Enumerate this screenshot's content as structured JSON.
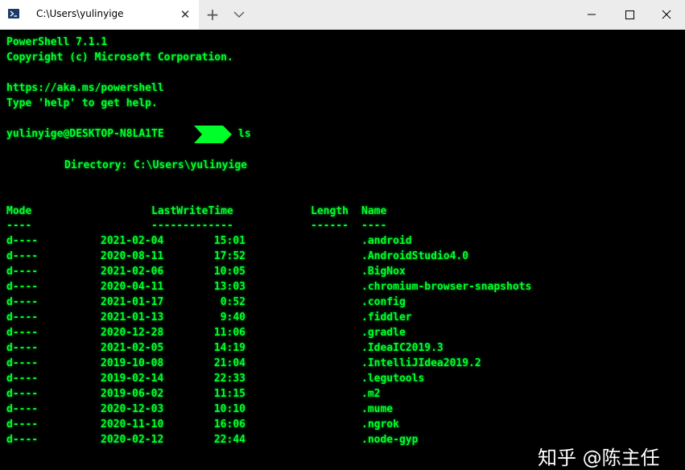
{
  "window": {
    "tab_title": "C:\\Users\\yulinyige",
    "tab_icon": "powershell-icon",
    "close_tab_glyph": "✕",
    "new_tab_glyph": "+",
    "tab_menu_icon": "chevron-down-icon",
    "controls": [
      "minimize-icon",
      "maximize-icon",
      "close-icon"
    ]
  },
  "colors": {
    "terminal_text": "#00ff2a",
    "terminal_bg": "#000000",
    "titlebar_bg": "#ececec"
  },
  "terminal": {
    "banner1": "PowerShell 7.1.1",
    "banner2": "Copyright (c) Microsoft Corporation.",
    "banner3": "https://aka.ms/powershell",
    "banner4": "Type 'help' to get help.",
    "prompt_user": "yulinyige@DESKTOP-N8LA1TE",
    "command": "ls",
    "directory_line": "Directory: C:\\Users\\yulinyige",
    "headers": {
      "mode": "Mode",
      "lastwritetime": "LastWriteTime",
      "length": "Length",
      "name": "Name"
    },
    "header_rules": {
      "mode": "----",
      "lastwritetime": "-------------",
      "length": "------",
      "name": "----"
    },
    "rows": [
      {
        "mode": "d----",
        "date": "2021-02-04",
        "time": "15:01",
        "name": ".android"
      },
      {
        "mode": "d----",
        "date": "2020-08-11",
        "time": "17:52",
        "name": ".AndroidStudio4.0"
      },
      {
        "mode": "d----",
        "date": "2021-02-06",
        "time": "10:05",
        "name": ".BigNox"
      },
      {
        "mode": "d----",
        "date": "2020-04-11",
        "time": "13:03",
        "name": ".chromium-browser-snapshots"
      },
      {
        "mode": "d----",
        "date": "2021-01-17",
        "time": "0:52",
        "name": ".config"
      },
      {
        "mode": "d----",
        "date": "2021-01-13",
        "time": "9:40",
        "name": ".fiddler"
      },
      {
        "mode": "d----",
        "date": "2020-12-28",
        "time": "11:06",
        "name": ".gradle"
      },
      {
        "mode": "d----",
        "date": "2021-02-05",
        "time": "14:19",
        "name": ".IdeaIC2019.3"
      },
      {
        "mode": "d----",
        "date": "2019-10-08",
        "time": "21:04",
        "name": ".IntelliJIdea2019.2"
      },
      {
        "mode": "d----",
        "date": "2019-02-14",
        "time": "22:33",
        "name": ".legutools"
      },
      {
        "mode": "d----",
        "date": "2019-06-02",
        "time": "11:15",
        "name": ".m2"
      },
      {
        "mode": "d----",
        "date": "2020-12-03",
        "time": "10:10",
        "name": ".mume"
      },
      {
        "mode": "d----",
        "date": "2020-11-10",
        "time": "16:06",
        "name": ".ngrok"
      },
      {
        "mode": "d----",
        "date": "2020-02-12",
        "time": "22:44",
        "name": ".node-gyp"
      }
    ]
  },
  "watermark": "知乎 @陈主任"
}
